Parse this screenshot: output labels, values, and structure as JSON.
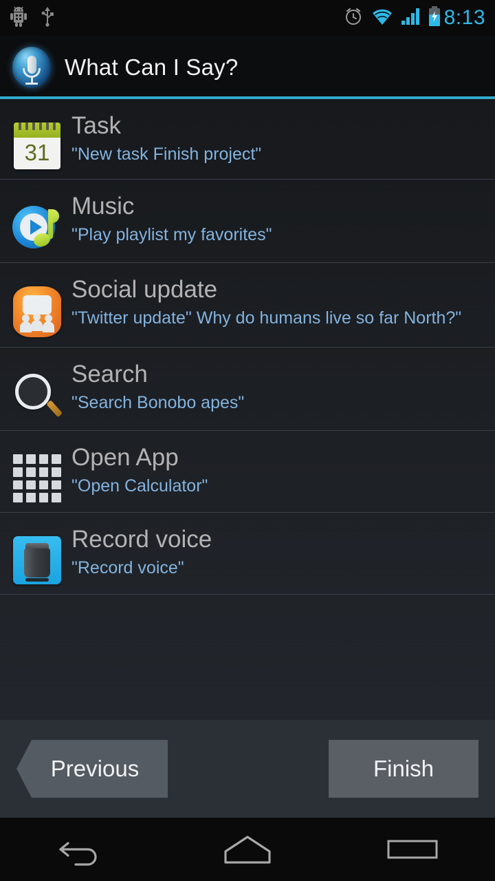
{
  "status_bar": {
    "left_icons": [
      {
        "name": "android-debug-icon",
        "glyph": "android"
      },
      {
        "name": "usb-icon",
        "glyph": "usb"
      }
    ],
    "right_icons": [
      {
        "name": "alarm-clock-icon",
        "glyph": "alarm"
      },
      {
        "name": "wifi-icon",
        "glyph": "wifi"
      },
      {
        "name": "cellular-signal-icon",
        "glyph": "signal"
      },
      {
        "name": "battery-charging-icon",
        "glyph": "battery"
      }
    ],
    "clock": "8:13",
    "clock_color": "#2eb8e6"
  },
  "header": {
    "title": "What Can I Say?",
    "icon": "microphone-icon",
    "accent_color": "#33a8cc"
  },
  "list": {
    "items": [
      {
        "icon": "calendar-icon",
        "title": "Task",
        "example": "\"New task Finish project\"",
        "calendar_day": "31"
      },
      {
        "icon": "music-note-icon",
        "title": "Music",
        "example": "\"Play playlist my favorites\""
      },
      {
        "icon": "social-group-icon",
        "title": "Social update",
        "example": "\"Twitter update\" Why do humans live so far North?\""
      },
      {
        "icon": "magnifier-icon",
        "title": "Search",
        "example": "\"Search Bonobo apes\""
      },
      {
        "icon": "app-grid-icon",
        "title": "Open App",
        "example": "\"Open Calculator\""
      },
      {
        "icon": "microphone-recorder-icon",
        "title": "Record voice",
        "example": "\"Record voice\""
      }
    ]
  },
  "buttons": {
    "previous_label": "Previous",
    "finish_label": "Finish"
  },
  "nav_bar": {
    "back_label": "back-icon",
    "home_label": "home-icon",
    "recents_label": "recents-icon"
  },
  "colors": {
    "title_text": "#b3b3b3",
    "example_text": "#83b3df",
    "list_background": "#17191c",
    "button_bar_background": "#2b3037"
  }
}
